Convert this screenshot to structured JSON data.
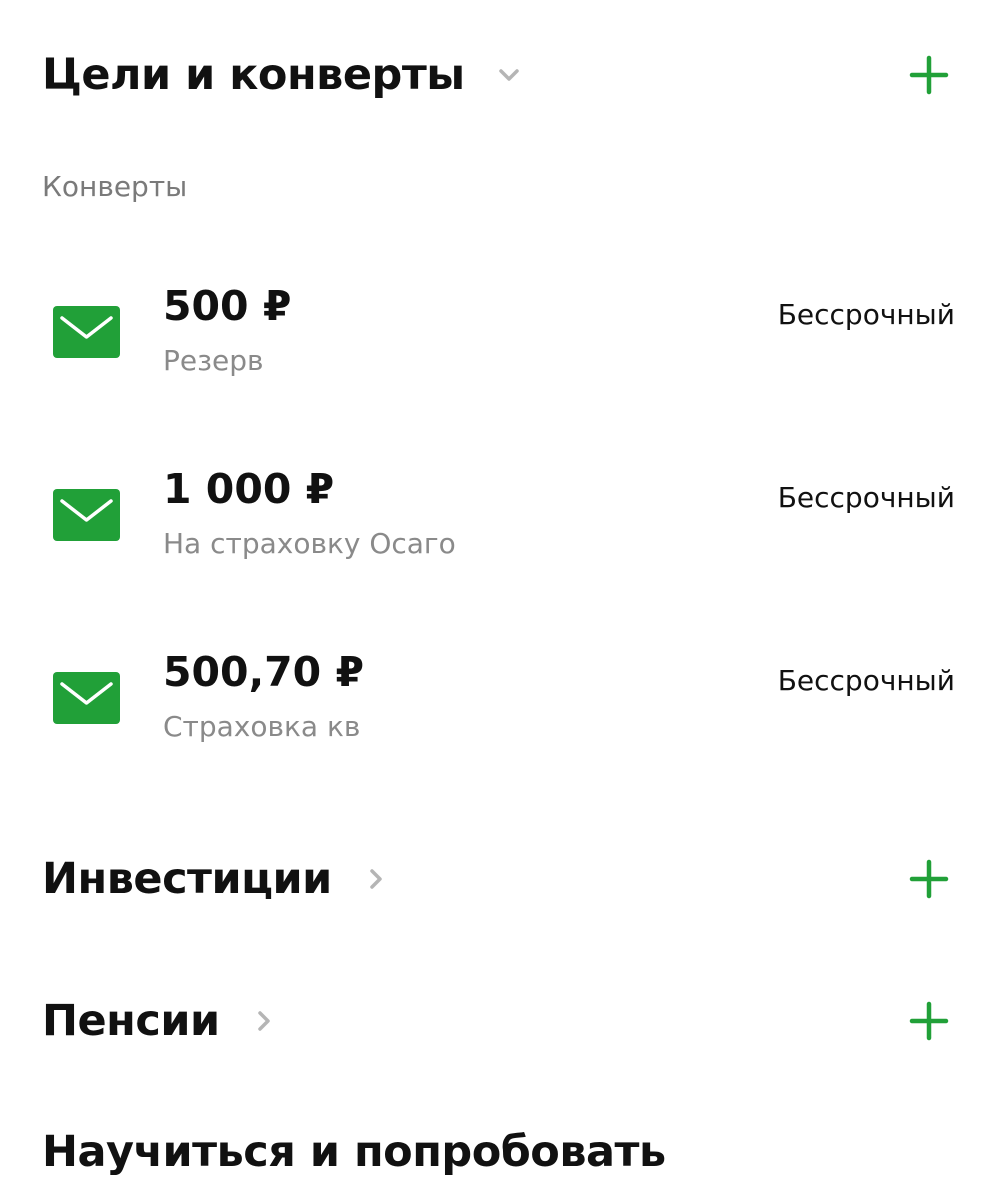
{
  "goals_section": {
    "title": "Цели и конверты",
    "chevron_icon": "chevron-down-icon",
    "add_icon": "plus-icon"
  },
  "envelopes": {
    "subheading": "Конверты",
    "items": [
      {
        "amount": "500 ₽",
        "name": "Резерв",
        "term": "Бессрочный",
        "icon": "envelope-icon"
      },
      {
        "amount": "1 000 ₽",
        "name": "На страховку Осаго",
        "term": "Бессрочный",
        "icon": "envelope-icon"
      },
      {
        "amount": "500,70 ₽",
        "name": "Страховка кв",
        "term": "Бессрочный",
        "icon": "envelope-icon"
      }
    ]
  },
  "investments_section": {
    "title": "Инвестиции",
    "chevron_icon": "chevron-right-icon",
    "add_icon": "plus-icon"
  },
  "pensions_section": {
    "title": "Пенсии",
    "chevron_icon": "chevron-right-icon",
    "add_icon": "plus-icon"
  },
  "learn_section": {
    "title": "Научиться и попробовать"
  },
  "colors": {
    "accent_green": "#21a038",
    "chevron_gray": "#b5b5b5",
    "secondary_text": "#8a8a8a"
  }
}
